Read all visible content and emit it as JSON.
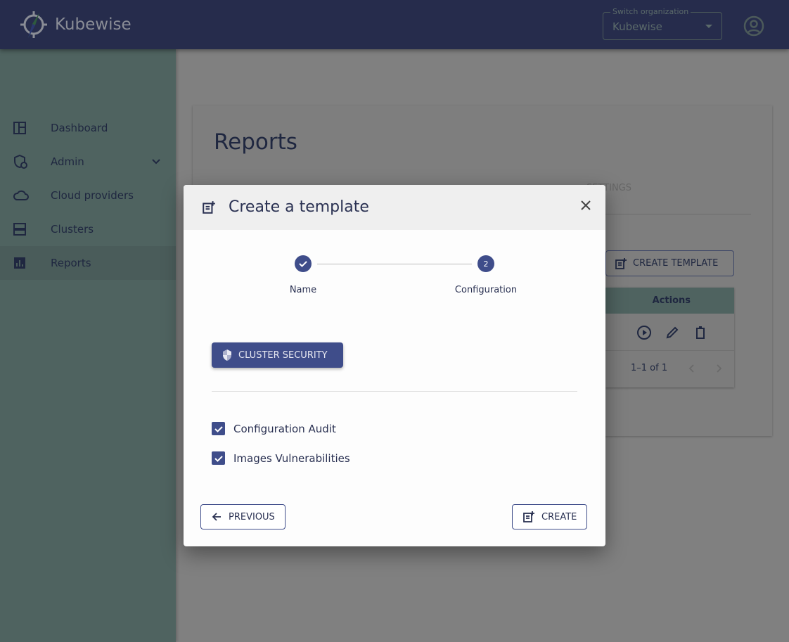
{
  "header": {
    "brand": "Kubewise",
    "org_label": "Switch organization",
    "org_value": "Kubewise"
  },
  "sidebar": {
    "items": [
      {
        "label": "Dashboard",
        "icon": "dashboard-icon"
      },
      {
        "label": "Admin",
        "icon": "admin-shield-icon"
      },
      {
        "label": "Cloud providers",
        "icon": "cloud-icon"
      },
      {
        "label": "Clusters",
        "icon": "server-icon"
      },
      {
        "label": "Reports",
        "icon": "chart-icon",
        "active": true
      }
    ]
  },
  "page": {
    "title": "Reports",
    "tab_partial": "SETTINGS",
    "create_template": "CREATE TEMPLATE",
    "actions_header": "Actions",
    "pagination": "1–1 of 1"
  },
  "modal": {
    "title": "Create a template",
    "steps": [
      {
        "label": "Name",
        "state": "completed"
      },
      {
        "label": "Configuration",
        "number": "2",
        "state": "active"
      }
    ],
    "category_button": "CLUSTER SECURITY",
    "options": [
      {
        "label": "Configuration Audit",
        "checked": true
      },
      {
        "label": "Images Vulnerabilities",
        "checked": true
      }
    ],
    "previous": "PREVIOUS",
    "create": "CREATE"
  },
  "colors": {
    "primary": "#3f4d8a",
    "header": "#262c4c",
    "sidebar": "#4f6360"
  }
}
